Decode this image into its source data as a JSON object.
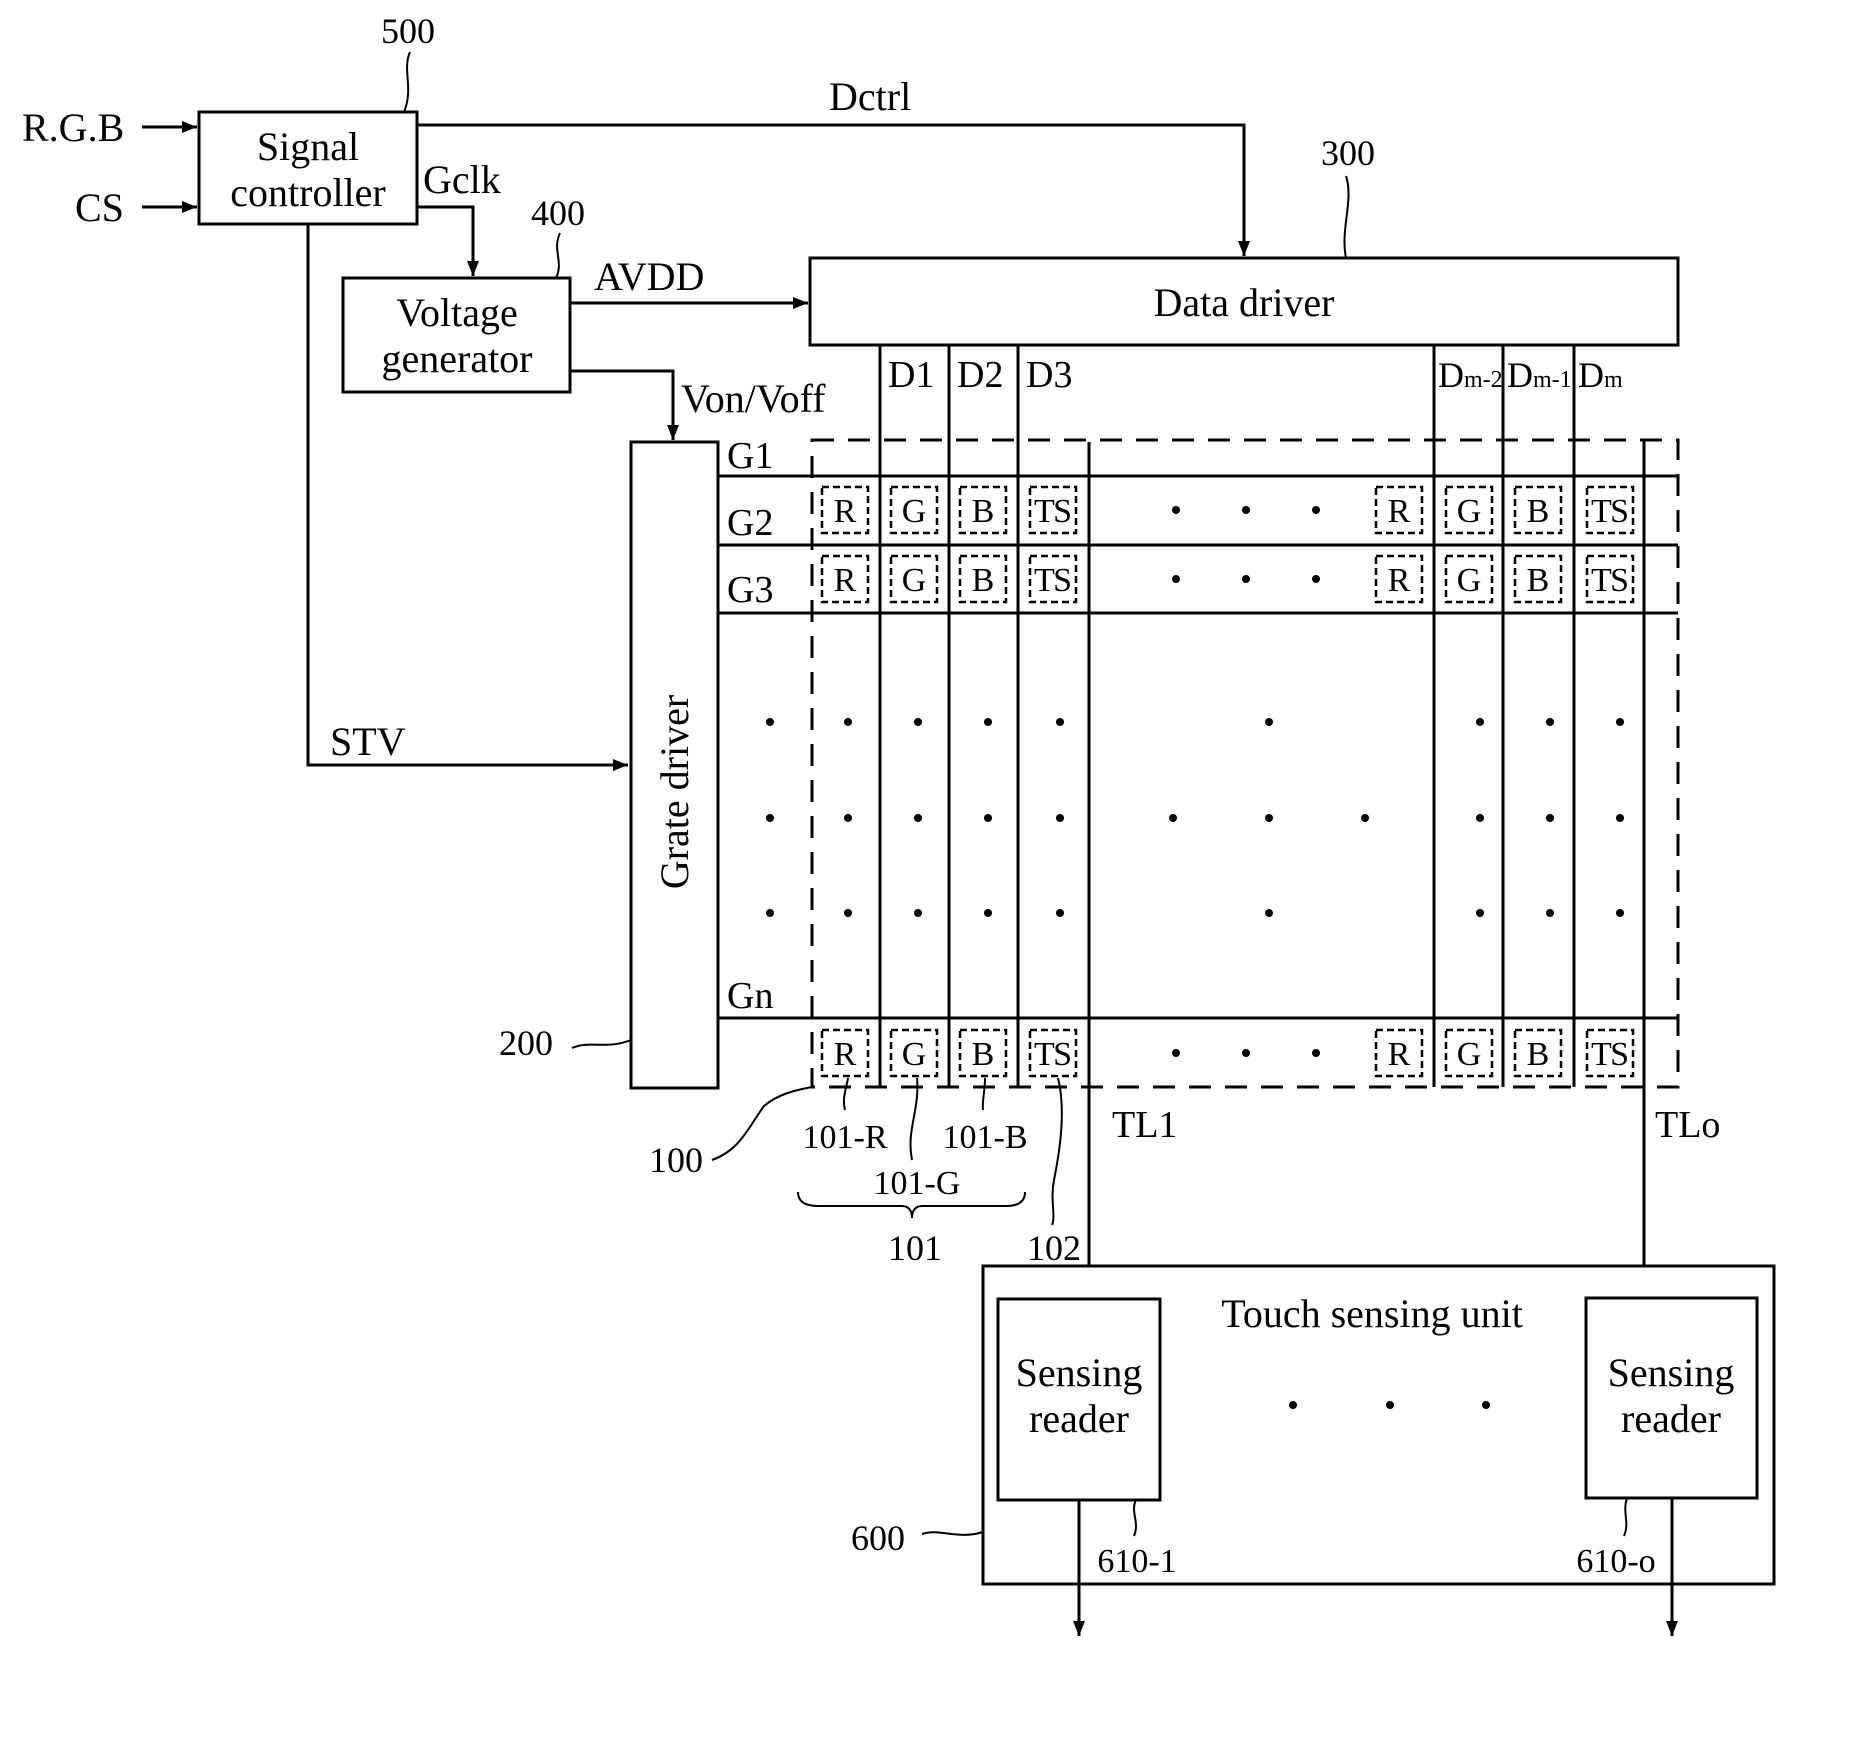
{
  "figure": {
    "blocks": {
      "signal_controller": {
        "ref": "500",
        "label_lines": [
          "Signal",
          "controller"
        ]
      },
      "voltage_generator": {
        "ref": "400",
        "label_lines": [
          "Voltage",
          "generator"
        ]
      },
      "data_driver": {
        "ref": "300",
        "label": "Data driver"
      },
      "gate_driver": {
        "ref": "200",
        "label": "Grate driver"
      },
      "panel": {
        "ref": "100"
      },
      "touch_sensing_unit": {
        "ref": "600",
        "label": "Touch sensing unit"
      },
      "sensing_reader_first": {
        "ref": "610-1",
        "label_lines": [
          "Sensing",
          "reader"
        ]
      },
      "sensing_reader_last": {
        "ref": "610-o",
        "label_lines": [
          "Sensing",
          "reader"
        ]
      }
    },
    "inputs": [
      "R.G.B",
      "CS"
    ],
    "signals": {
      "dctrl": "Dctrl",
      "gclk": "Gclk",
      "avdd": "AVDD",
      "von_voff": "Von/Voff",
      "stv": "STV"
    },
    "data_lines": {
      "left": [
        "D1",
        "D2",
        "D3"
      ],
      "right": [
        {
          "base": "D",
          "sub": "m-2"
        },
        {
          "base": "D",
          "sub": "m-1"
        },
        {
          "base": "D",
          "sub": "m"
        }
      ]
    },
    "gate_lines": [
      "G1",
      "G2",
      "G3",
      "Gn"
    ],
    "touch_lines": [
      "TL1",
      "TLo"
    ],
    "pixel_cells": [
      "R",
      "G",
      "B",
      "TS"
    ],
    "reference_labels": {
      "sub_pixel_r": "101-R",
      "sub_pixel_g": "101-G",
      "sub_pixel_b": "101-B",
      "pixel": "101",
      "touch_sensor": "102"
    }
  }
}
